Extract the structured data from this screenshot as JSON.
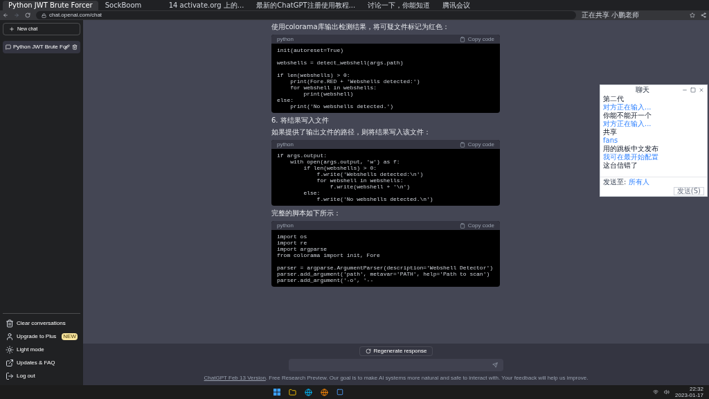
{
  "browser": {
    "tabs": [
      {
        "title": "Python JWT Brute Forcer",
        "selected": true
      },
      {
        "title": "SockBoom",
        "selected": false
      },
      {
        "title": "14 activate.org 上的...",
        "selected": false
      },
      {
        "title": "最新的ChatGPT注册使用教程...",
        "selected": false
      },
      {
        "title": "讨论一下，你能知道",
        "selected": false
      },
      {
        "title": "腾讯会议",
        "selected": false
      }
    ],
    "address": "chat.openai.com/chat",
    "notice": "正在共享 小鹏老师"
  },
  "sidebar": {
    "new_chat": "New chat",
    "conversations": [
      {
        "title": "Python JWT Brute For",
        "selected": true
      }
    ],
    "menu": [
      {
        "label": "Clear conversations",
        "kind": "clear"
      },
      {
        "label": "Upgrade to Plus",
        "kind": "plus",
        "badge": "NEW"
      },
      {
        "label": "Light mode",
        "kind": "light"
      },
      {
        "label": "Updates & FAQ",
        "kind": "link"
      },
      {
        "label": "Log out",
        "kind": "logout"
      }
    ]
  },
  "content": [
    {
      "kind": "text",
      "text": "使用colorama库输出检测结果，将可疑文件标记为红色："
    },
    {
      "kind": "code",
      "language": "python",
      "copy": "Copy code",
      "groups": [
        [
          "init(autoreset=True)"
        ],
        [
          "webshells = detect_webshell(args.path)"
        ],
        [
          "if len(webshells) > 0:",
          "    print(Fore.RED + 'Webshells detected:')",
          "    for webshell in webshells:",
          "        print(webshell)",
          "else:",
          "    print('No webshells detected.')"
        ]
      ]
    },
    {
      "kind": "text",
      "text": "6. 将结果写入文件"
    },
    {
      "kind": "text",
      "text": "如果提供了输出文件的路径，则将结果写入该文件："
    },
    {
      "kind": "code",
      "language": "python",
      "copy": "Copy code",
      "groups": [
        [
          "if args.output:",
          "    with open(args.output, 'w') as f:",
          "        if len(webshells) > 0:",
          "            f.write('Webshells detected:\\n')",
          "            for webshell in webshells:",
          "                f.write(webshell + '\\n')",
          "        else:",
          "            f.write('No webshells detected.\\n')"
        ]
      ]
    },
    {
      "kind": "text",
      "text": "完整的脚本如下所示："
    },
    {
      "kind": "code",
      "language": "python",
      "copy": "Copy code",
      "groups": [
        [
          "import os",
          "import re",
          "import argparse",
          "from colorama import init, Fore"
        ],
        [
          "parser = argparse.ArgumentParser(description='Webshell Detector')",
          "parser.add_argument('path', metavar='PATH', help='Path to scan')",
          "parser.add_argument('-o', '--"
        ]
      ]
    }
  ],
  "regenerate": "Regenerate response",
  "footer": {
    "link": "ChatGPT Feb 13 Version",
    "text": ". Free Research Preview. Our goal is to make AI systems more natural and safe to interact with. Your feedback will help us improve."
  },
  "chat_window": {
    "title": "聊天",
    "messages": [
      {
        "text": "第二代",
        "kind": "msg"
      },
      {
        "text": "对方正在输入...",
        "kind": "status"
      },
      {
        "text": "你能不能开一个",
        "kind": "msg"
      },
      {
        "text": "对方正在输入...",
        "kind": "status"
      },
      {
        "text": "共享",
        "kind": "msg"
      },
      {
        "text": "fans",
        "kind": "status"
      },
      {
        "text": "用的跳板中文发布",
        "kind": "msg"
      },
      {
        "text": "我可在最开始配置",
        "kind": "status"
      },
      {
        "text": "这台信错了",
        "kind": "msg"
      }
    ],
    "send_to_label": "发送至:",
    "send_to": "所有人",
    "send": "发送(S)"
  },
  "taskbar": {
    "time": "22:32",
    "date": "2023-01-17"
  }
}
